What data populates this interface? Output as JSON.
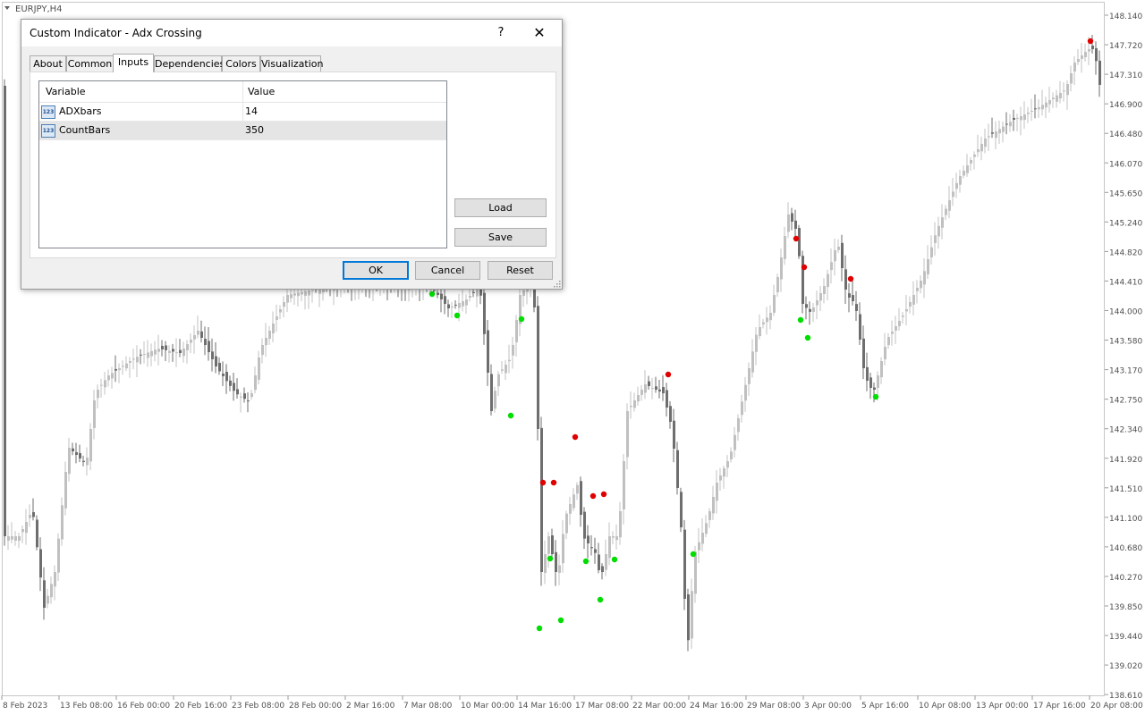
{
  "chart": {
    "symbol": "EURJPY,H4",
    "price_labels": [
      "148.140",
      "147.720",
      "147.310",
      "146.900",
      "146.480",
      "146.070",
      "145.650",
      "145.240",
      "144.820",
      "144.410",
      "144.000",
      "143.580",
      "143.170",
      "142.750",
      "142.340",
      "141.920",
      "141.510",
      "141.100",
      "140.680",
      "140.270",
      "139.850",
      "139.440",
      "139.020",
      "138.610"
    ],
    "time_labels": [
      "8 Feb 2023",
      "13 Feb 08:00",
      "16 Feb 00:00",
      "20 Feb 16:00",
      "23 Feb 08:00",
      "28 Feb 00:00",
      "2 Mar 16:00",
      "7 Mar 08:00",
      "10 Mar 00:00",
      "14 Mar 16:00",
      "17 Mar 08:00",
      "22 Mar 00:00",
      "24 Mar 16:00",
      "29 Mar 08:00",
      "3 Apr 00:00",
      "5 Apr 16:00",
      "10 Apr 08:00",
      "13 Apr 00:00",
      "17 Apr 16:00",
      "20 Apr 08:00"
    ],
    "colors": {
      "bull": "#c0c0c0",
      "bear": "#6e6e6e",
      "signal_up": "#00dd00",
      "signal_down": "#e00000",
      "axis_text": "#505050"
    }
  },
  "dialog": {
    "title": "Custom Indicator - Adx Crossing",
    "help_label": "?",
    "close_label": "✕",
    "tabs": [
      "About",
      "Common",
      "Inputs",
      "Dependencies",
      "Colors",
      "Visualization"
    ],
    "active_tab": "Inputs",
    "table": {
      "headers": [
        "Variable",
        "Value"
      ],
      "rows": [
        {
          "variable": "ADXbars",
          "value": "14",
          "icon": "123"
        },
        {
          "variable": "CountBars",
          "value": "350",
          "icon": "123"
        }
      ]
    },
    "load_label": "Load",
    "save_label": "Save",
    "ok_label": "OK",
    "cancel_label": "Cancel",
    "reset_label": "Reset"
  }
}
